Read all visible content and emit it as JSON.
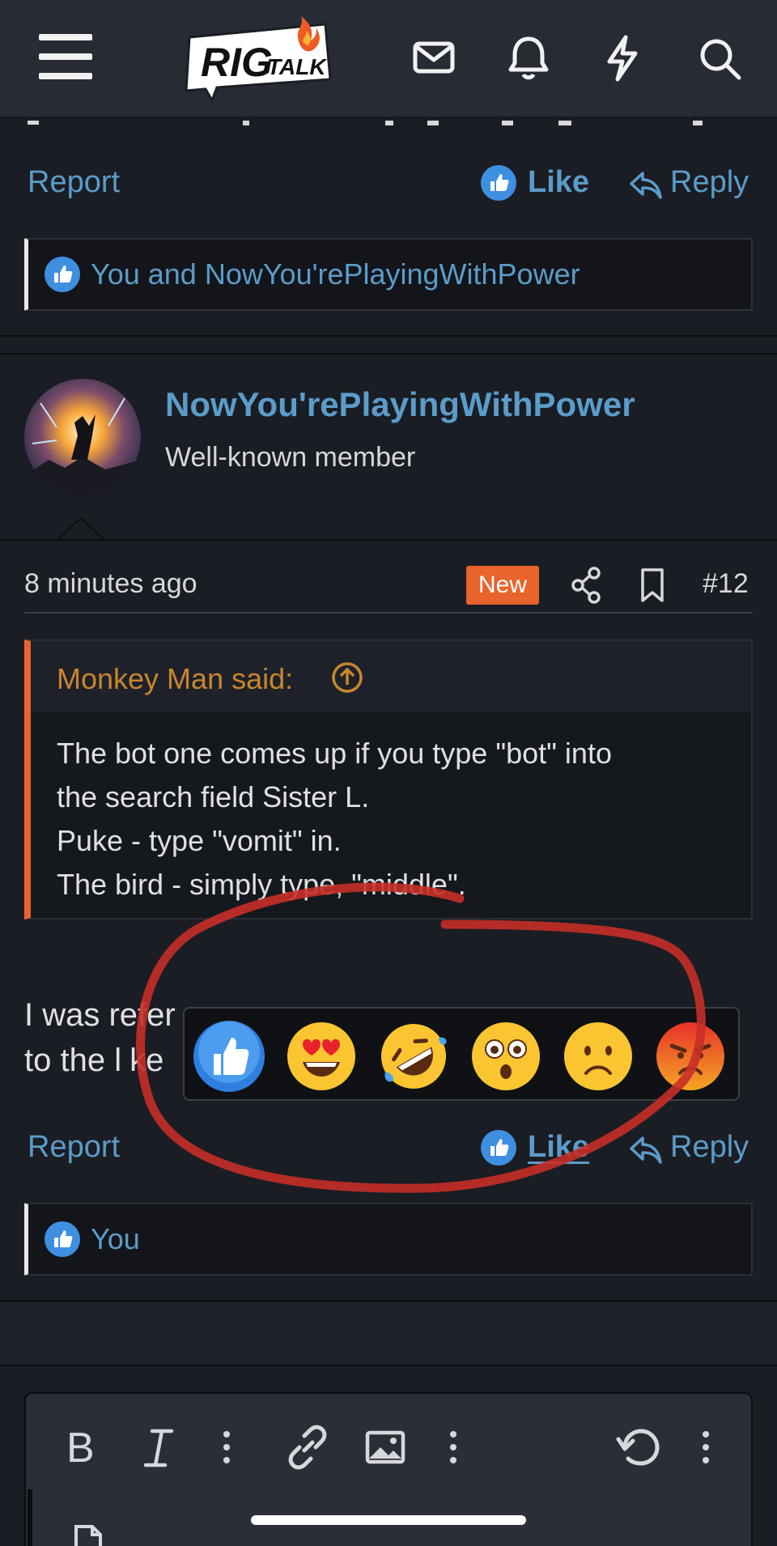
{
  "header": {
    "logo_main": "RIG",
    "logo_sub": "TALK",
    "icons": [
      "menu-icon",
      "mail-icon",
      "bell-icon",
      "lightning-icon",
      "search-icon"
    ]
  },
  "prev_post": {
    "report": "Report",
    "like": "Like",
    "reply": "Reply",
    "reactions_text": "You and NowYou'rePlayingWithPower"
  },
  "post": {
    "username": "NowYou'rePlayingWithPower",
    "user_title": "Well-known member",
    "time": "8 minutes ago",
    "badge": "New",
    "number": "#12",
    "quote": {
      "author": "Monkey Man said:",
      "lines": [
        "The bot one comes up if you type \"bot\" into",
        "the search field Sister L.",
        "Puke - type \"vomit\" in.",
        "The bird - simply type, \"middle\"."
      ]
    },
    "body_lines": [
      "I was refer",
      "to the l",
      "ke"
    ],
    "report": "Report",
    "like": "Like",
    "reply": "Reply",
    "reactions_text": "You"
  },
  "reaction_picker": {
    "emojis": [
      "like",
      "heart-eyes",
      "rofl",
      "flushed",
      "slightly-frowning",
      "angry"
    ]
  },
  "editor": {
    "tools": [
      "bold-icon",
      "italic-icon",
      "more-icon",
      "link-icon",
      "image-icon",
      "more-icon",
      "undo-icon",
      "more-icon"
    ]
  },
  "colors": {
    "accent": "#5b9cc9",
    "badge": "#e9632c",
    "annotation": "#c62f28",
    "background": "#1a1d24"
  }
}
